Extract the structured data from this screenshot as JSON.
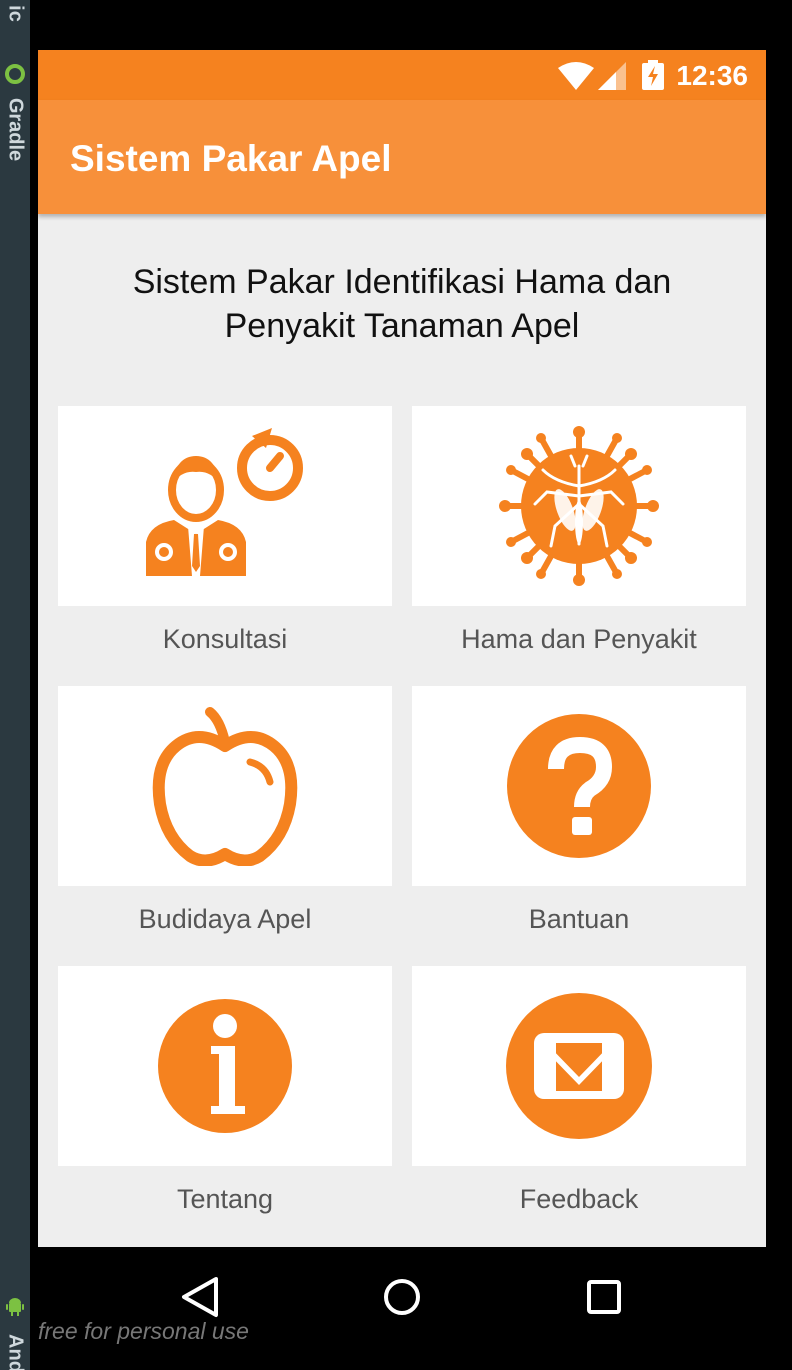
{
  "ide": {
    "top_label": "ic",
    "gradle_label": "Gradle",
    "android_label": "And"
  },
  "status": {
    "time": "12:36",
    "wifi_icon": "wifi-icon",
    "signal_icon": "signal-icon",
    "battery_icon": "battery-charging-icon"
  },
  "appbar": {
    "title": "Sistem Pakar Apel"
  },
  "headline": "Sistem Pakar Identifikasi Hama dan Penyakit Tanaman Apel",
  "menu": [
    {
      "label": "Konsultasi",
      "icon": "doctor-consult-icon"
    },
    {
      "label": "Hama dan Penyakit",
      "icon": "mosquito-virus-icon"
    },
    {
      "label": "Budidaya Apel",
      "icon": "apple-icon"
    },
    {
      "label": "Bantuan",
      "icon": "question-icon"
    },
    {
      "label": "Tentang",
      "icon": "info-icon"
    },
    {
      "label": "Feedback",
      "icon": "mail-icon"
    }
  ],
  "nav": {
    "back": "back-icon",
    "home": "home-icon",
    "recents": "recents-icon"
  },
  "watermark": "free for personal use",
  "colors": {
    "accent": "#f5821f",
    "appbar": "#f7903a",
    "background": "#eeeeee"
  }
}
